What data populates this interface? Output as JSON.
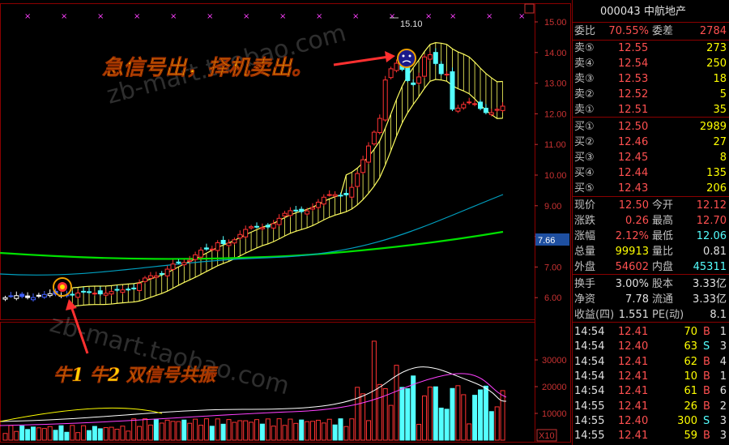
{
  "stock": {
    "code": "000043",
    "name": "中航地产"
  },
  "axis": {
    "price_ticks": [
      "15.00",
      "14.00",
      "13.00",
      "12.00",
      "11.00",
      "10.00",
      "9.00",
      "8.00",
      "7.00",
      "6.00"
    ],
    "current_price_marker": "7.66",
    "volume_ticks": [
      "30000",
      "20000",
      "10000"
    ],
    "volume_unit": "X10"
  },
  "chart": {
    "high_label": "15.10",
    "annotation_sell": "急信号出，择机卖出。",
    "annotation_buy": "牛1 牛2 双信号共振",
    "watermark": "zb-mart.taobao.com"
  },
  "quote": {
    "weibi": {
      "label": "委比",
      "value": "70.55%"
    },
    "weicha": {
      "label": "委差",
      "value": "2784"
    },
    "asks": [
      {
        "label": "卖⑤",
        "price": "12.55",
        "vol": "273"
      },
      {
        "label": "卖④",
        "price": "12.54",
        "vol": "250"
      },
      {
        "label": "卖③",
        "price": "12.53",
        "vol": "18"
      },
      {
        "label": "卖②",
        "price": "12.52",
        "vol": "5"
      },
      {
        "label": "卖①",
        "price": "12.51",
        "vol": "35"
      }
    ],
    "bids": [
      {
        "label": "买①",
        "price": "12.50",
        "vol": "2989"
      },
      {
        "label": "买②",
        "price": "12.46",
        "vol": "27"
      },
      {
        "label": "买③",
        "price": "12.45",
        "vol": "8"
      },
      {
        "label": "买④",
        "price": "12.44",
        "vol": "135"
      },
      {
        "label": "买⑤",
        "price": "12.43",
        "vol": "206"
      }
    ],
    "stats": [
      {
        "l1": "现价",
        "v1": "12.50",
        "l2": "今开",
        "v2": "12.12"
      },
      {
        "l1": "涨跌",
        "v1": "0.26",
        "l2": "最高",
        "v2": "12.70"
      },
      {
        "l1": "涨幅",
        "v1": "2.12%",
        "l2": "最低",
        "v2": "12.06"
      },
      {
        "l1": "总量",
        "v1": "99913",
        "l2": "量比",
        "v2": "0.81"
      },
      {
        "l1": "外盘",
        "v1": "54602",
        "l2": "内盘",
        "v2": "45311"
      }
    ],
    "fundamentals": [
      {
        "l1": "换手",
        "v1": "3.00%",
        "l2": "股本",
        "v2": "3.33亿"
      },
      {
        "l1": "净资",
        "v1": "7.78",
        "l2": "流通",
        "v2": "3.33亿"
      },
      {
        "l1": "收益(四)",
        "v1": "1.551",
        "l2": "PE(动)",
        "v2": "8.1"
      }
    ],
    "ticks": [
      {
        "time": "14:54",
        "price": "12.41",
        "vol": "70",
        "side": "B",
        "n": "1"
      },
      {
        "time": "14:54",
        "price": "12.40",
        "vol": "63",
        "side": "S",
        "n": "3"
      },
      {
        "time": "14:54",
        "price": "12.41",
        "vol": "62",
        "side": "B",
        "n": "4"
      },
      {
        "time": "14:54",
        "price": "12.41",
        "vol": "10",
        "side": "B",
        "n": "1"
      },
      {
        "time": "14:54",
        "price": "12.41",
        "vol": "61",
        "side": "B",
        "n": "6"
      },
      {
        "time": "14:55",
        "price": "12.41",
        "vol": "26",
        "side": "B",
        "n": "2"
      },
      {
        "time": "14:55",
        "price": "12.40",
        "vol": "300",
        "side": "S",
        "n": "3"
      },
      {
        "time": "14:55",
        "price": "12.41",
        "vol": "59",
        "side": "B",
        "n": "3"
      }
    ]
  },
  "colors": {
    "up": "#ff3232",
    "down": "#54ffff",
    "gold": "#ffff00",
    "green_ma": "#00e000",
    "cyan_ma": "#00a0c0",
    "frame": "#8b0000"
  }
}
